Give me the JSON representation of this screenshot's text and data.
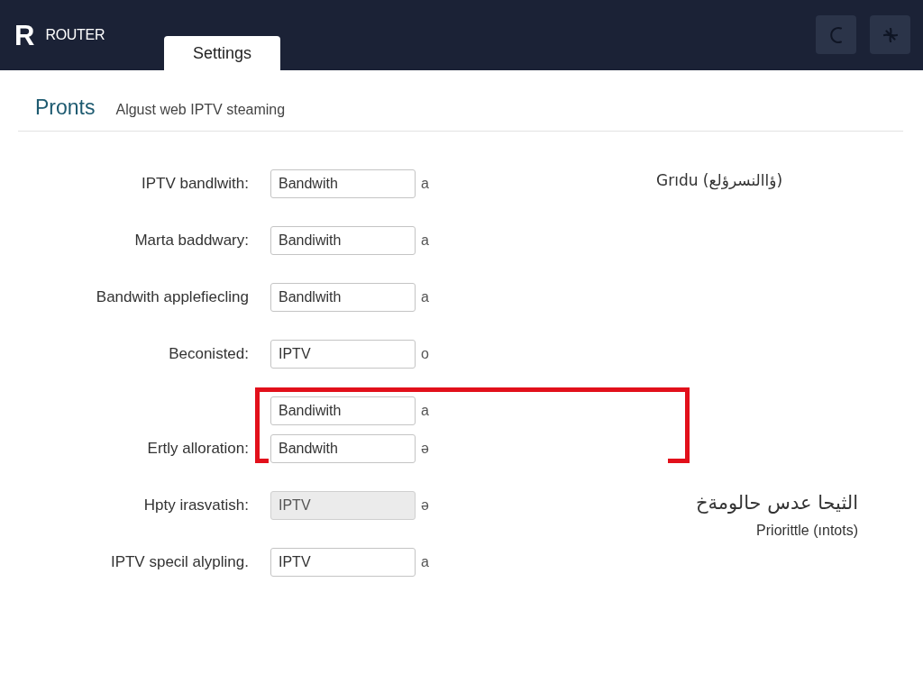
{
  "header": {
    "logo": "R",
    "brand": "ROUTER",
    "tabs": [
      {
        "label": "Settings",
        "selected": true
      }
    ]
  },
  "page": {
    "title": "Pronts",
    "subtitle": "Algust web IPTV steaming"
  },
  "form": {
    "rows": [
      {
        "label": "IPTV bandlwith:",
        "highlighted": false,
        "fields": [
          {
            "value": "Bandwith",
            "unit": "a",
            "disabled": false
          }
        ]
      },
      {
        "label": "Marta baddwary:",
        "highlighted": false,
        "fields": [
          {
            "value": "Bandiwith",
            "unit": "a",
            "disabled": false
          }
        ]
      },
      {
        "label": "Bandwith applefiecling",
        "highlighted": false,
        "fields": [
          {
            "value": "Bandlwith",
            "unit": "a",
            "disabled": false
          }
        ]
      },
      {
        "label": "Beconisted:",
        "highlighted": false,
        "fields": [
          {
            "value": "IPTV",
            "unit": "o",
            "disabled": false
          }
        ]
      },
      {
        "label": "Ertly alloration:",
        "highlighted": true,
        "fields": [
          {
            "value": "Bandiwith",
            "unit": "a",
            "disabled": false
          },
          {
            "value": "Bandwith",
            "unit": "ə",
            "disabled": false
          }
        ]
      },
      {
        "label": "Hpty irasvatish:",
        "highlighted": false,
        "fields": [
          {
            "value": "IPTV",
            "unit": "ə",
            "disabled": true
          }
        ]
      },
      {
        "label": "IPTV specil alypling.",
        "highlighted": false,
        "fields": [
          {
            "value": "IPTV",
            "unit": "a",
            "disabled": false
          }
        ]
      }
    ]
  },
  "aside": {
    "note": "Grıdu (ؤاالنسرؤلع)",
    "callout": {
      "title": "الثيحا عدس حالومةخ",
      "caption": "Priorittle (ıntots)"
    }
  }
}
